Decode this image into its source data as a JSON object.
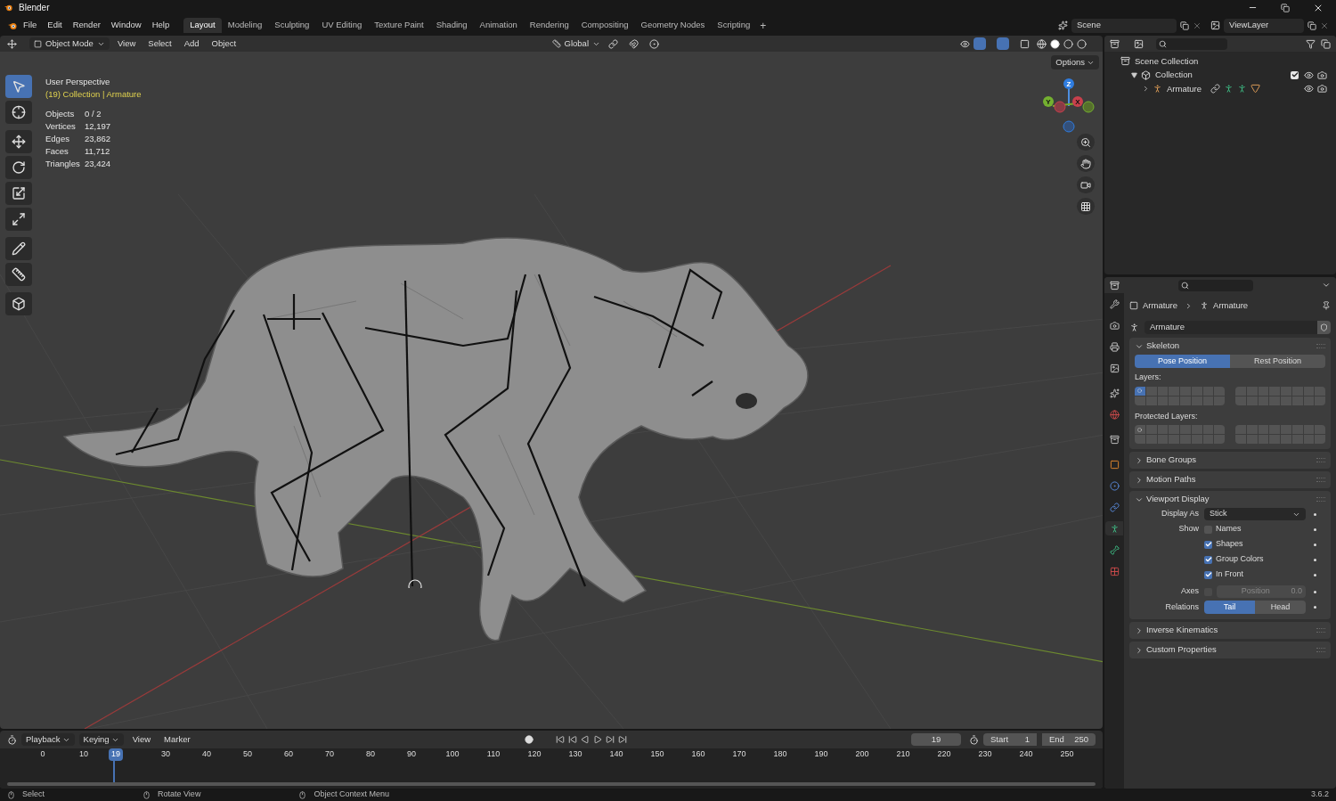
{
  "title_bar": {
    "title": "Blender"
  },
  "menu": [
    "File",
    "Edit",
    "Render",
    "Window",
    "Help"
  ],
  "workspaces": [
    {
      "label": "Layout",
      "selected": true
    },
    {
      "label": "Modeling",
      "selected": false
    },
    {
      "label": "Sculpting",
      "selected": false
    },
    {
      "label": "UV Editing",
      "selected": false
    },
    {
      "label": "Texture Paint",
      "selected": false
    },
    {
      "label": "Shading",
      "selected": false
    },
    {
      "label": "Animation",
      "selected": false
    },
    {
      "label": "Rendering",
      "selected": false
    },
    {
      "label": "Compositing",
      "selected": false
    },
    {
      "label": "Geometry Nodes",
      "selected": false
    },
    {
      "label": "Scripting",
      "selected": false
    }
  ],
  "add_workspace": "+",
  "scene": {
    "label": "Scene"
  },
  "view_layer": {
    "label": "ViewLayer"
  },
  "viewport": {
    "mode": "Object Mode",
    "menus": [
      "View",
      "Select",
      "Add",
      "Object"
    ],
    "orientation": "Global",
    "options": "Options",
    "overlay_title": "User Perspective",
    "overlay_subtitle": "(19) Collection | Armature",
    "stats": [
      {
        "label": "Objects",
        "value": "0 / 2"
      },
      {
        "label": "Vertices",
        "value": "12,197"
      },
      {
        "label": "Edges",
        "value": "23,862"
      },
      {
        "label": "Faces",
        "value": "11,712"
      },
      {
        "label": "Triangles",
        "value": "23,424"
      }
    ],
    "tools": [
      {
        "kind": "select",
        "selected": true
      },
      {
        "kind": "cursor",
        "selected": false
      },
      {
        "kind": "move",
        "selected": false
      },
      {
        "kind": "rotate",
        "selected": false
      },
      {
        "kind": "scale",
        "selected": false
      },
      {
        "kind": "transform",
        "selected": false
      },
      {
        "kind": "annotate",
        "selected": false
      },
      {
        "kind": "measure",
        "selected": false
      },
      {
        "kind": "add-cube",
        "selected": false
      }
    ],
    "gizmo": {
      "x": "X",
      "y": "Y",
      "z": "Z"
    }
  },
  "outliner": {
    "items": [
      {
        "label": "Scene Collection",
        "kind": "scene",
        "children": [
          {
            "label": "Collection",
            "kind": "collection",
            "expanded": true,
            "checked": true,
            "children": [
              {
                "label": "Armature",
                "kind": "armature",
                "expanded": false
              }
            ]
          }
        ]
      }
    ]
  },
  "properties": {
    "tabs": [
      {
        "kind": "tool",
        "selected": false
      },
      {
        "kind": "render",
        "selected": false
      },
      {
        "kind": "output",
        "selected": false
      },
      {
        "kind": "view-layer",
        "selected": false
      },
      {
        "kind": "scene",
        "selected": false
      },
      {
        "kind": "world",
        "selected": false
      },
      {
        "kind": "collection",
        "selected": false
      },
      {
        "kind": "object",
        "selected": false
      },
      {
        "kind": "physics",
        "selected": false
      },
      {
        "kind": "constraints",
        "selected": false
      },
      {
        "kind": "data",
        "selected": true
      },
      {
        "kind": "bone",
        "selected": false
      },
      {
        "kind": "texture",
        "selected": false
      }
    ],
    "breadcrumb": [
      "Armature",
      "Armature"
    ],
    "data_name": "Armature",
    "panels": [
      {
        "title": "Skeleton",
        "kind": "skeleton",
        "expanded": true,
        "pose_buttons": [
          {
            "label": "Pose Position",
            "selected": true
          },
          {
            "label": "Rest Position",
            "selected": false
          }
        ],
        "layers_label": "Layers:",
        "layers": [
          true,
          false,
          false,
          false,
          false,
          false,
          false,
          false,
          false,
          false,
          false,
          false,
          false,
          false,
          false,
          false,
          false,
          false,
          false,
          false,
          false,
          false,
          false,
          false,
          false,
          false,
          false,
          false,
          false,
          false,
          false,
          false
        ],
        "protected_label": "Protected Layers:",
        "protected": [
          false,
          false,
          false,
          false,
          false,
          false,
          false,
          false,
          false,
          false,
          false,
          false,
          false,
          false,
          false,
          false,
          false,
          false,
          false,
          false,
          false,
          false,
          false,
          false,
          false,
          false,
          false,
          false,
          false,
          false,
          false,
          false
        ]
      },
      {
        "title": "Bone Groups",
        "kind": "plain",
        "expanded": false
      },
      {
        "title": "Motion Paths",
        "kind": "plain",
        "expanded": false
      },
      {
        "title": "Viewport Display",
        "kind": "display",
        "expanded": true,
        "display_as_label": "Display As",
        "display_as": "Stick",
        "show_label": "Show",
        "show": [
          {
            "label": "Names",
            "checked": false
          },
          {
            "label": "Shapes",
            "checked": true
          },
          {
            "label": "Group Colors",
            "checked": true
          },
          {
            "label": "In Front",
            "checked": true
          }
        ],
        "axes_label": "Axes",
        "axes_checked": false,
        "axes_position_label": "Position",
        "axes_position_value": "0.0",
        "relations_label": "Relations",
        "relations": [
          {
            "label": "Tail",
            "selected": true
          },
          {
            "label": "Head",
            "selected": false
          }
        ]
      },
      {
        "title": "Inverse Kinematics",
        "kind": "plain",
        "expanded": false
      },
      {
        "title": "Custom Properties",
        "kind": "plain",
        "expanded": false
      }
    ]
  },
  "timeline": {
    "menus": [
      "Playback",
      "Keying",
      "View",
      "Marker"
    ],
    "current_frame": "19",
    "start_label": "Start",
    "start": "1",
    "end_label": "End",
    "end": "250",
    "ruler": [
      {
        "label": "0",
        "kind": "tick"
      },
      {
        "label": "10",
        "kind": "tick"
      },
      {
        "label": "19",
        "kind": "playhead"
      },
      {
        "label": "30",
        "kind": "tick"
      },
      {
        "label": "40",
        "kind": "tick"
      },
      {
        "label": "50",
        "kind": "tick"
      },
      {
        "label": "60",
        "kind": "tick"
      },
      {
        "label": "70",
        "kind": "tick"
      },
      {
        "label": "80",
        "kind": "tick"
      },
      {
        "label": "90",
        "kind": "tick"
      },
      {
        "label": "100",
        "kind": "tick"
      },
      {
        "label": "110",
        "kind": "tick"
      },
      {
        "label": "120",
        "kind": "tick"
      },
      {
        "label": "130",
        "kind": "tick"
      },
      {
        "label": "140",
        "kind": "tick"
      },
      {
        "label": "150",
        "kind": "tick"
      },
      {
        "label": "160",
        "kind": "tick"
      },
      {
        "label": "170",
        "kind": "tick"
      },
      {
        "label": "180",
        "kind": "tick"
      },
      {
        "label": "190",
        "kind": "tick"
      },
      {
        "label": "200",
        "kind": "tick"
      },
      {
        "label": "210",
        "kind": "tick"
      },
      {
        "label": "220",
        "kind": "tick"
      },
      {
        "label": "230",
        "kind": "tick"
      },
      {
        "label": "240",
        "kind": "tick"
      },
      {
        "label": "250",
        "kind": "tick"
      }
    ]
  },
  "status_bar": {
    "hints": [
      "Select",
      "Rotate View",
      "Object Context Menu"
    ],
    "version": "3.6.2"
  }
}
